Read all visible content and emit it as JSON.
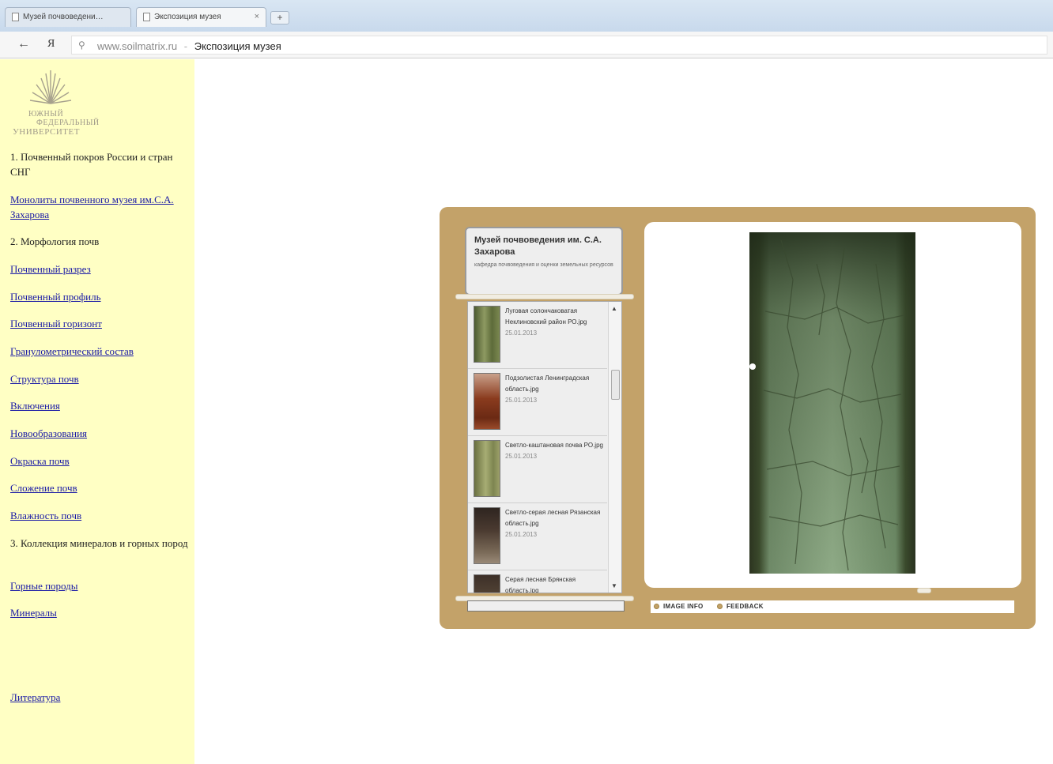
{
  "browser": {
    "tabs": [
      {
        "label": "Музей почвоведени…"
      },
      {
        "label": "Экспозиция музея"
      }
    ],
    "tab_close": "×",
    "new_tab": "+",
    "back_icon": "←",
    "yandex_icon": "Я",
    "search_icon": "⚲",
    "url": "www.soilmatrix.ru",
    "url_separator": "-",
    "page_title": "Экспозиция музея"
  },
  "sidebar": {
    "logo_lines": [
      "ЮЖНЫЙ",
      "ФЕДЕРАЛЬНЫЙ",
      "УНИВЕРСИТЕТ"
    ],
    "items": [
      {
        "text": "1. Почвенный покров России и стран СНГ",
        "type": "heading"
      },
      {
        "text": "Монолиты почвенного музея им.С.А. Захарова",
        "type": "link"
      },
      {
        "text": "2. Морфология почв",
        "type": "heading"
      },
      {
        "text": "Почвенный разрез",
        "type": "link"
      },
      {
        "text": "Почвенный профиль",
        "type": "link"
      },
      {
        "text": "Почвенный горизонт",
        "type": "link"
      },
      {
        "text": "Гранулометрический состав",
        "type": "link"
      },
      {
        "text": "Структура почв",
        "type": "link"
      },
      {
        "text": "Включения",
        "type": "link"
      },
      {
        "text": "Новообразования",
        "type": "link"
      },
      {
        "text": "Окраска почв",
        "type": "link"
      },
      {
        "text": "Сложение почв",
        "type": "link"
      },
      {
        "text": "Влажность почв",
        "type": "link"
      },
      {
        "text": "3. Коллекция минералов и горных пород",
        "type": "heading"
      },
      {
        "text": "Горные породы",
        "type": "link"
      },
      {
        "text": "Минералы",
        "type": "link"
      },
      {
        "text": "Литература",
        "type": "link"
      }
    ]
  },
  "gallery": {
    "title": "Музей почвоведения им. С.А. Захарова",
    "subtitle": "кафедра почвоведения и оценки земельных ресурсов",
    "thumbnails": [
      {
        "name": "Луговая солончаковатая Неклиновский район РО.jpg",
        "date": "25.01.2013",
        "color": "#7a8a4e"
      },
      {
        "name": "Подзолистая Ленинградская область.jpg",
        "date": "25.01.2013",
        "color": "#9a4a2a"
      },
      {
        "name": "Светло-каштановая почва РО.jpg",
        "date": "25.01.2013",
        "color": "#8a8f58"
      },
      {
        "name": "Светло-серая лесная Рязанская область.jpg",
        "date": "25.01.2013",
        "color": "#4a3a30"
      },
      {
        "name": "Серая лесная Брянская область.jpg",
        "date": "",
        "color": "#5a4a3a"
      }
    ],
    "scroll_up": "▲",
    "scroll_down": "▼",
    "footer": {
      "image_info": "IMAGE INFO",
      "feedback": "FEEDBACK"
    },
    "colors": {
      "frame": "#c3a269",
      "sidebar_bg": "#ffffc4",
      "link": "#1a1aa6"
    }
  }
}
